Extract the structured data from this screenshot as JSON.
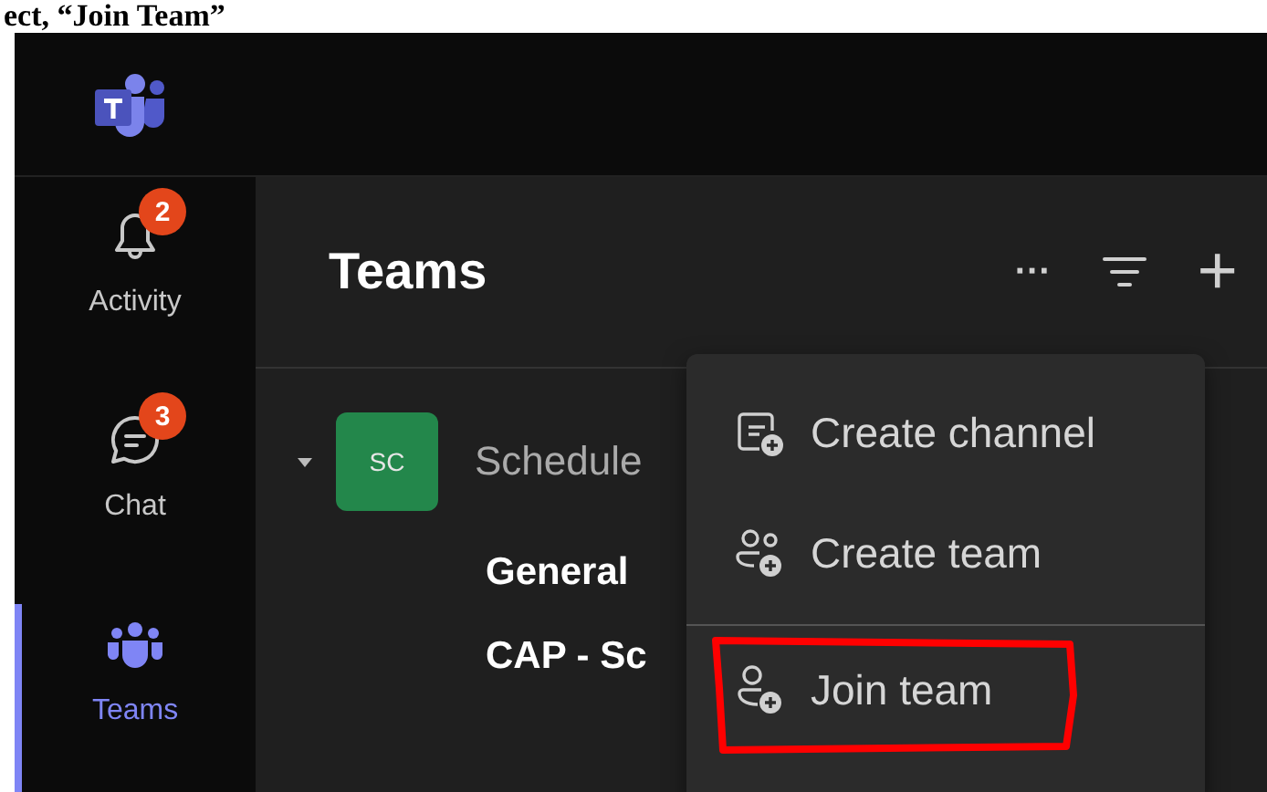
{
  "caption": "ect, “Join Team”",
  "rail": [
    {
      "kind": "activity",
      "label": "Activity",
      "badge": "2",
      "selected": false
    },
    {
      "kind": "chat",
      "label": "Chat",
      "badge": "3",
      "selected": false
    },
    {
      "kind": "teams",
      "label": "Teams",
      "selected": true
    }
  ],
  "panel": {
    "title": "Teams",
    "more": "···",
    "add": "+"
  },
  "team": {
    "expanded": true,
    "initials": "SC",
    "color": "#23874b",
    "name": "Schedule",
    "channels": [
      "General",
      "CAP - Sc"
    ]
  },
  "menu": [
    {
      "kind": "channel",
      "label": "Create channel",
      "annotated": false
    },
    {
      "kind": "team",
      "label": "Create team",
      "annotated": false
    },
    {
      "kind": "join",
      "label": "Join team",
      "annotated": true
    }
  ]
}
